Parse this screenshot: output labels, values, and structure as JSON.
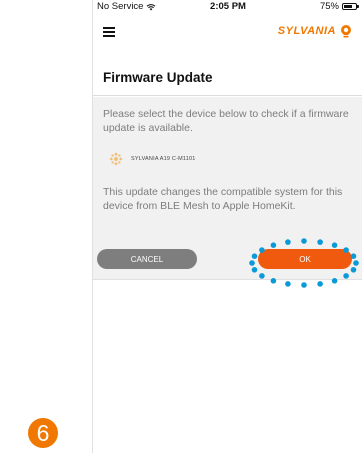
{
  "status_bar": {
    "carrier": "No Service",
    "time": "2:05 PM",
    "battery": "75%",
    "battery_level": 0.75
  },
  "header": {
    "brand": "SYLVANIA",
    "brand_color": "#f07800"
  },
  "page": {
    "title": "Firmware Update",
    "prompt": "Please select the device below to check if a firmware update is available.",
    "device_name": "SYLVANIA A19 C-M1101",
    "notice": "This update changes the compatible system for this device from BLE Mesh to Apple HomeKit."
  },
  "buttons": {
    "cancel": "CANCEL",
    "ok": "OK",
    "ok_color": "#f05a0e",
    "highlight_color": "#0a9ad8"
  },
  "step": {
    "number": "6"
  }
}
